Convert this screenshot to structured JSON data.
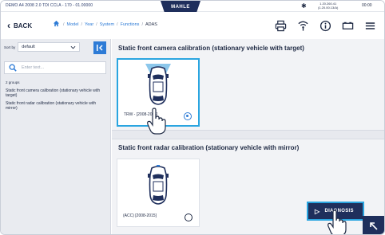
{
  "topbar": {
    "vehicle_info": "DEMO A4 2008 2.0 TDI CCLA - 170 - 01.00000",
    "brand": "MAHLE",
    "voltage_line1": "1.20.260.41",
    "voltage_line2": "(1.20.00.13/A)",
    "clock": "00:00"
  },
  "nav": {
    "back_label": "BACK",
    "breadcrumb": [
      "Model",
      "Year",
      "System",
      "Functions"
    ],
    "breadcrumb_current": "ADAS",
    "tools": [
      "print-icon",
      "wifi-icon",
      "info-icon",
      "battery-icon",
      "menu-icon"
    ]
  },
  "sidebar": {
    "sort_label": "Sort by",
    "sort_value": "default",
    "search_placeholder": "Enter text...",
    "groups_count": "2 groups",
    "groups": [
      "Static front camera calibration (stationary vehicle with target)",
      "Static front radar calibration (stationary vehicle with mirror)"
    ]
  },
  "main": {
    "sections": [
      {
        "title": "Static front camera calibration (stationary vehicle with target)",
        "card_label": "TRW - [2008-2015]",
        "selected": true
      },
      {
        "title": "Static front radar calibration (stationary vehicle with mirror)",
        "card_label": "(ACC) [2008-2015]",
        "selected": false
      }
    ],
    "diagnosis_label": "DIAGNOSIS"
  },
  "colors": {
    "navy": "#1f2f5c",
    "accent_blue": "#2d7bd6",
    "highlight_cyan": "#2aa5e0"
  }
}
